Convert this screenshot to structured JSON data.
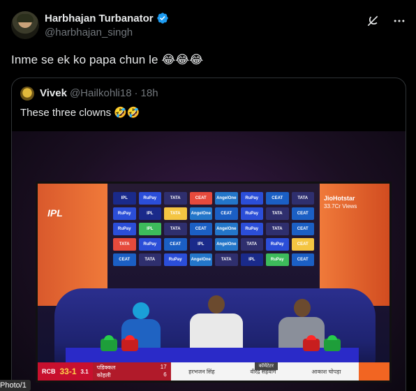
{
  "post": {
    "author": {
      "display_name": "Harbhajan Turbanator",
      "handle": "@harbhajan_singh",
      "verified": true
    },
    "text": "Inme se ek ko papa chun le 😂😂😂",
    "actions": {
      "grok_icon": "grok-icon",
      "more_icon": "more-icon"
    }
  },
  "quote": {
    "author": {
      "display_name": "Vivek",
      "handle": "@Hailkohli18",
      "separator": "·",
      "time": "18h"
    },
    "text": "These three clowns 🤣🤣"
  },
  "media": {
    "broadcast": {
      "league": "IPL",
      "jio_title": "JioHotstar",
      "jio_views": "33.7Cr Views",
      "score": {
        "team": "RCB",
        "runs": "33-1",
        "overs": "3.1",
        "opponent": "v SRH",
        "batter1": "पडिक्कल",
        "batter1_score": "17",
        "batter2": "कोहली",
        "batter2_score": "6"
      },
      "commentary_label": "कॉमेंटेटर",
      "commentators": [
        "हरभजन सिंह",
        "वीरेंद्र सहवाग",
        "आकाश चोपड़ा"
      ]
    },
    "sponsor_tiles": [
      "IPL",
      "RuPay",
      "TATA",
      "CEAT",
      "AngelOne",
      "RuPay",
      "CEAT",
      "TATA",
      "RuPay",
      "IPL",
      "TATA",
      "AngelOne",
      "CEAT",
      "RuPay",
      "TATA",
      "CEAT",
      "RuPay",
      "IPL",
      "TATA",
      "CEAT",
      "AngelOne",
      "RuPay",
      "TATA",
      "CEAT",
      "TATA",
      "RuPay",
      "CEAT",
      "IPL",
      "AngelOne",
      "TATA",
      "RuPay",
      "CEAT",
      "CEAT",
      "TATA",
      "RuPay",
      "AngelOne",
      "TATA",
      "IPL",
      "RuPay",
      "CEAT"
    ]
  },
  "photo_tag": "Photo/1",
  "colors": {
    "background": "#000000",
    "text_primary": "#e7e9ea",
    "text_secondary": "#71767b",
    "border": "#2f3336",
    "verified_blue": "#1d9bf0"
  }
}
